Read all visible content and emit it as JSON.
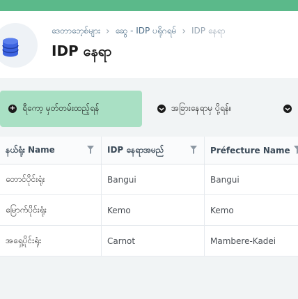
{
  "header": {
    "breadcrumb": [
      "ဒေတာဘေ့စ်များ",
      "ဆွေ - IDP ပရိုဂရမ်",
      "IDP နေရာ"
    ],
    "title": "IDP နေရာ"
  },
  "toolbar": {
    "add_label": "ရီကော့ မှတ်တမ်းထည့်ရန်",
    "import_label": "အခြားနေရာမှ ပို့ရန်။"
  },
  "table": {
    "columns": [
      "နယ်ရုံး Name",
      "IDP နေရာအမည်",
      "Préfecture Name"
    ],
    "rows": [
      [
        "တောင်ပိုင်းရုံး",
        "Bangui",
        "Bangui"
      ],
      [
        "မြောက်ပိုင်းရုံး",
        "Kemo",
        "Kemo"
      ],
      [
        "အရှေ့ပိုင်းရုံး",
        "Carnot",
        "Mambere-Kadei"
      ]
    ]
  },
  "colors": {
    "accent": "#5bb98a",
    "primary_button": "#a9e0c4"
  },
  "icons": [
    "database-icon",
    "plus-circle-icon",
    "download-circle-icon",
    "filter-icon"
  ]
}
